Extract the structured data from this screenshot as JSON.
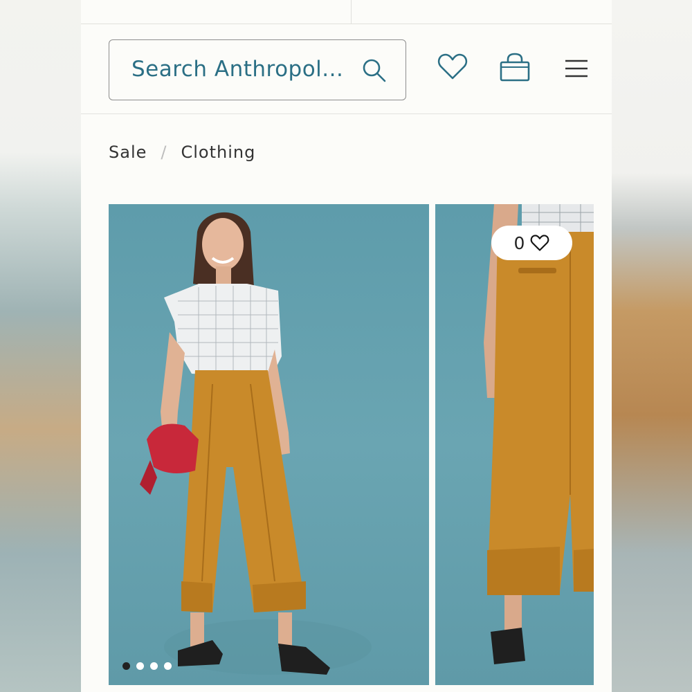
{
  "search": {
    "placeholder": "Search Anthropol..."
  },
  "breadcrumb": {
    "items": [
      "Sale",
      "Clothing"
    ],
    "separator": "/"
  },
  "product": {
    "image_count": 4,
    "active_image": 1,
    "favorites_count": "0"
  },
  "colors": {
    "accent": "#2b6f85",
    "photo_background": "#64a1ae",
    "pants": "#c98a2a",
    "bag": "#c8283a"
  },
  "icons": {
    "search": "search-icon",
    "wishlist": "heart-icon",
    "bag": "shopping-bag-icon",
    "menu": "hamburger-menu-icon"
  }
}
